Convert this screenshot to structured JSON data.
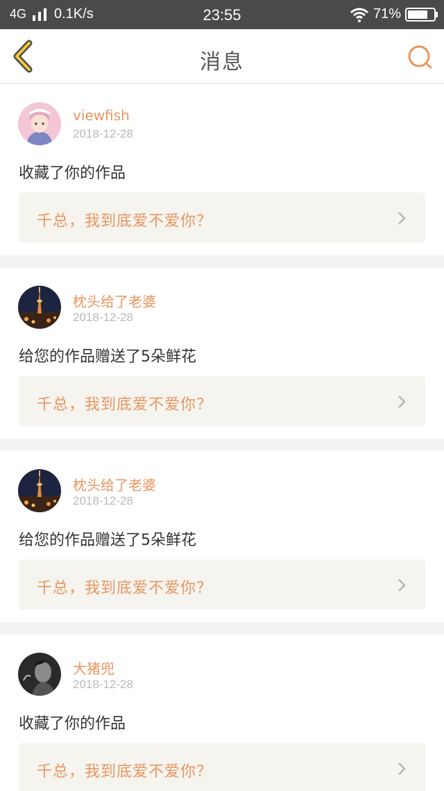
{
  "status_bar": {
    "network": "4G",
    "speed": "0.1K/s",
    "time": "23:55",
    "battery": "71%"
  },
  "header": {
    "title": "消息",
    "back_icon": "chevron-left-icon",
    "search_icon": "search-icon",
    "accent_color": "#e8955f"
  },
  "messages": [
    {
      "username": "viewfish",
      "date": "2018-12-28",
      "action": "收藏了你的作品",
      "work_title": "千总，我到底爱不爱你？",
      "avatar": "anime-girl-avatar"
    },
    {
      "username": "枕头给了老婆",
      "date": "2018-12-28",
      "action": "给您的作品赠送了5朵鲜花",
      "work_title": "千总，我到底爱不爱你？",
      "avatar": "night-tower-avatar"
    },
    {
      "username": "枕头给了老婆",
      "date": "2018-12-28",
      "action": "给您的作品赠送了5朵鲜花",
      "work_title": "千总，我到底爱不爱你？",
      "avatar": "night-tower-avatar"
    },
    {
      "username": "大猪兜",
      "date": "2018-12-28",
      "action": "收藏了你的作品",
      "work_title": "千总，我到底爱不爱你？",
      "avatar": "bw-portrait-avatar"
    }
  ]
}
